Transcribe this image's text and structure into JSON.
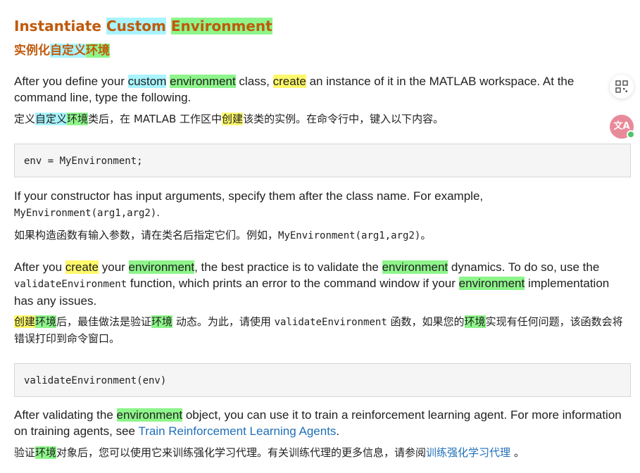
{
  "heading": {
    "w1": "Instantiate ",
    "w2": "Custom",
    "w3": " ",
    "w4": "Environment"
  },
  "subheading": {
    "w1": "实例化",
    "w2": "自定义",
    "w3": "环境"
  },
  "para1": {
    "t1": "After you define your ",
    "h1": "custom",
    "t2": " ",
    "h2": "environment",
    "t3": " class, ",
    "h3": "create",
    "t4": " an instance of it in the MATLAB workspace. At the command line, type the following."
  },
  "para1_zh": {
    "t1": "定义",
    "h1": "自定义",
    "h2": "环境",
    "t2": "类后，在 MATLAB 工作区中",
    "h3": "创建",
    "t3": "该类的实例。在命令行中，键入以下内容。"
  },
  "code1": "env = MyEnvironment;",
  "para2": {
    "t1": "If your constructor has input arguments, specify them after the class name. For example, ",
    "code": "MyEnvironment(arg1,arg2)",
    "t2": "."
  },
  "para2_zh": {
    "t1": "如果构造函数有输入参数，请在类名后指定它们。例如，",
    "code": "MyEnvironment(arg1,arg2)",
    "t2": "。"
  },
  "para3": {
    "t1": "After you ",
    "h1": "create",
    "t2": " your ",
    "h2": "environment",
    "t3": ", the best practice is to validate the ",
    "h3": "environment",
    "t4": " dynamics. To do so, use the ",
    "code": "validateEnvironment",
    "t5": " function, which prints an error to the command window if your ",
    "h4": "environment",
    "t6": " implementation has any issues."
  },
  "para3_zh": {
    "h1": "创建",
    "h2": "环境",
    "t1": "后，最佳做法是验证",
    "h3": "环境",
    "t2": " 动态。为此，请使用 ",
    "code": "validateEnvironment",
    "t3": " 函数，如果您的",
    "h4": "环境",
    "t4": "实现有任何问题，该函数会将错误打印到命令窗口。"
  },
  "code2": "validateEnvironment(env)",
  "para4": {
    "t1": "After validating the ",
    "h1": "environment",
    "t2": " object, you can use it to train a reinforcement learning agent. For more information on training agents, see ",
    "link": "Train Reinforcement Learning Agents",
    "t3": "."
  },
  "para4_zh": {
    "t1": "验证",
    "h1": "环境",
    "t2": "对象后，您可以使用它来训练强化学习代理。有关训练代理的更多信息，请参阅",
    "link": "训练强化学习代理",
    "t3": " 。"
  },
  "floating": {
    "grid_button_icon": "grid-icon",
    "translate_button_icon": "translate-icon",
    "translate_glyph": "文A",
    "accent": "#e98a9a"
  }
}
